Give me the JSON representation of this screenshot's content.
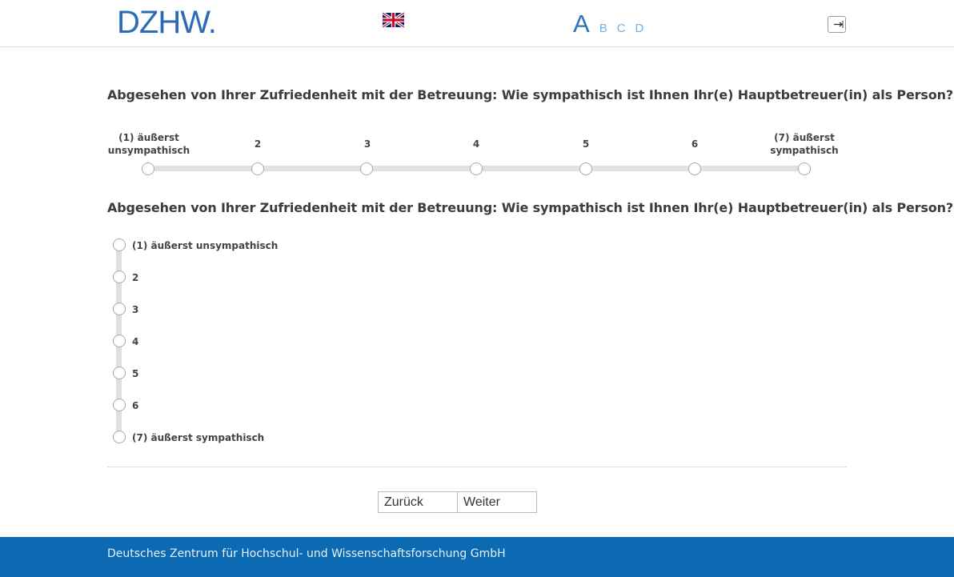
{
  "header": {
    "logo_text": "DZHW",
    "logo_dot": ".",
    "language_flag_icon": "uk-flag-icon",
    "font_size_options": [
      "A",
      "B",
      "C",
      "D"
    ],
    "logout_icon": "logout-arrow-icon"
  },
  "question1": {
    "text": "Abgesehen von Ihrer Zufriedenheit mit der Betreuung: Wie sympathisch ist Ihnen Ihr(e) Hauptbetreuer(in) als Person?",
    "options": [
      {
        "line1": "(1) äußerst",
        "line2": "unsympathisch"
      },
      {
        "line1": "2",
        "line2": ""
      },
      {
        "line1": "3",
        "line2": ""
      },
      {
        "line1": "4",
        "line2": ""
      },
      {
        "line1": "5",
        "line2": ""
      },
      {
        "line1": "6",
        "line2": ""
      },
      {
        "line1": "(7) äußerst",
        "line2": "sympathisch"
      }
    ]
  },
  "question2": {
    "text": "Abgesehen von Ihrer Zufriedenheit mit der Betreuung: Wie sympathisch ist Ihnen Ihr(e) Hauptbetreuer(in) als Person?",
    "options": [
      "(1) äußerst unsympathisch",
      "2",
      "3",
      "4",
      "5",
      "6",
      "(7) äußerst sympathisch"
    ]
  },
  "navigation": {
    "back_label": "Zurück",
    "next_label": "Weiter"
  },
  "footer": {
    "text": "Deutsches Zentrum für Hochschul- und Wissenschaftsforschung GmbH"
  },
  "colors": {
    "brand_blue": "#2b6cb8",
    "footer_blue": "#0b6ab2",
    "track_gray": "#e1e1e1"
  }
}
